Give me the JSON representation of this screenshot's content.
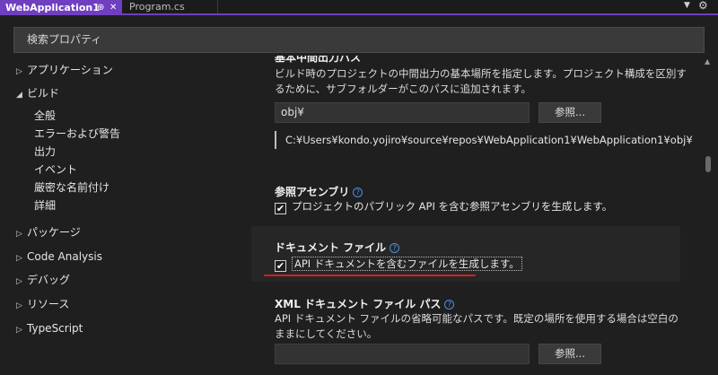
{
  "tabs": {
    "active": {
      "label": "WebApplication1",
      "pin": "⊕",
      "close": "✕"
    },
    "inactive": {
      "label": "Program.cs"
    },
    "dropdown_icon": "chevron-down-icon",
    "settings_icon": "gear-icon"
  },
  "search": {
    "placeholder": "検索プロパティ"
  },
  "nav": {
    "items": [
      {
        "label": "アプリケーション",
        "arrow": "▷"
      },
      {
        "label": "ビルド",
        "arrow": "◢"
      },
      {
        "label": "パッケージ",
        "arrow": "▷"
      },
      {
        "label": "Code Analysis",
        "arrow": "▷"
      },
      {
        "label": "デバッグ",
        "arrow": "▷"
      },
      {
        "label": "リソース",
        "arrow": "▷"
      },
      {
        "label": "TypeScript",
        "arrow": "▷"
      }
    ],
    "build_children": [
      "全般",
      "エラーおよび警告",
      "出力",
      "イベント",
      "厳密な名前付け",
      "詳細"
    ]
  },
  "content": {
    "base_output": {
      "heading": "基本中間出力パス",
      "description": "ビルド時のプロジェクトの中間出力の基本場所を指定します。プロジェクト構成を区別するために、サブフォルダーがこのパスに追加されます。",
      "value": "obj¥",
      "browse": "参照...",
      "resolved_path": "C:¥Users¥kondo.yojiro¥source¥repos¥WebApplication1¥WebApplication1¥obj¥"
    },
    "ref_assembly": {
      "heading": "参照アセンブリ",
      "checkbox_label": "プロジェクトのパブリック API を含む参照アセンブリを生成します。",
      "checked": "✔"
    },
    "doc_file": {
      "heading": "ドキュメント ファイル",
      "checkbox_label": "API ドキュメントを含むファイルを生成します。",
      "checked": "✔"
    },
    "xml_doc_path": {
      "heading": "XML ドキュメント ファイル パス",
      "description": "API ドキュメント ファイルの省略可能なパスです。既定の場所を使用する場合は空白のままにしてください。",
      "value": "",
      "browse": "参照..."
    },
    "help_glyph": "?"
  },
  "colors": {
    "accent": "#6f3fbf",
    "underline": "#d61f1f",
    "help": "#4e8fe6"
  }
}
